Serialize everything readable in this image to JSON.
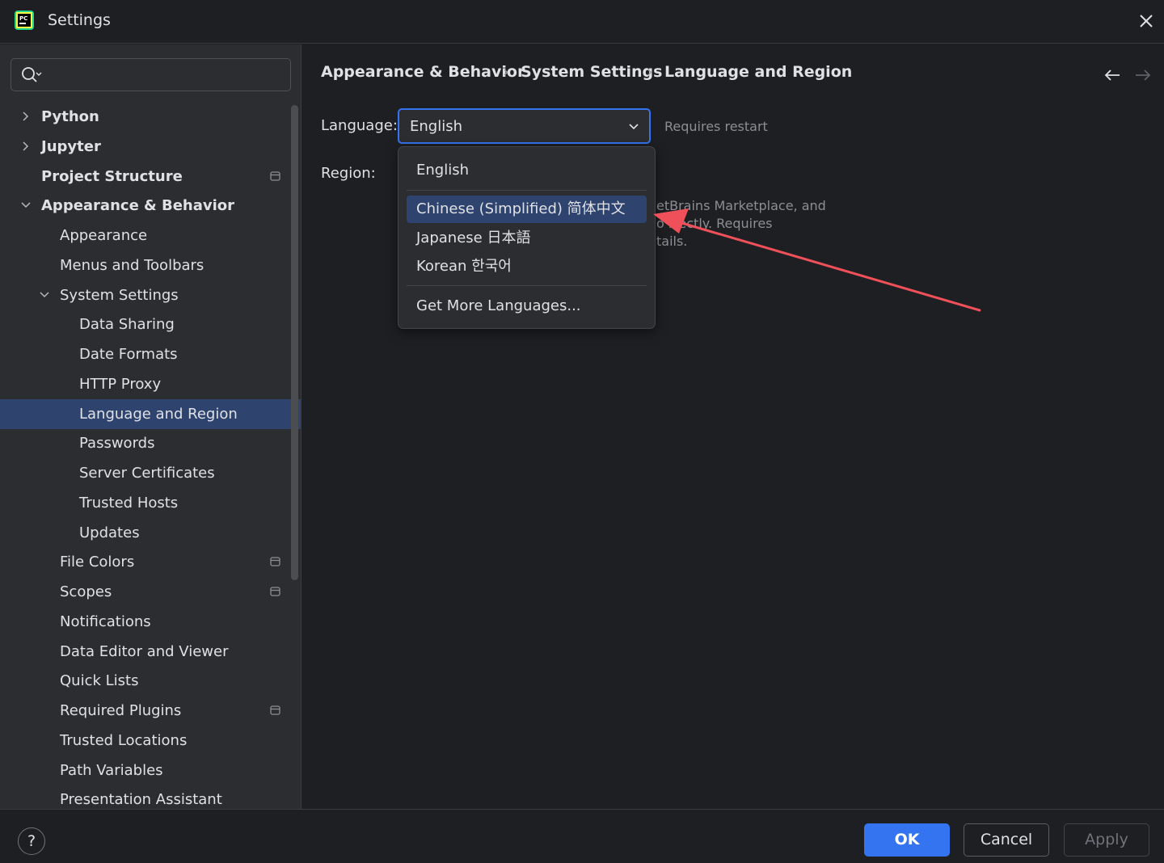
{
  "window": {
    "title": "Settings"
  },
  "search": {
    "placeholder": "",
    "value": ""
  },
  "sidebar": {
    "items": [
      {
        "label": "Python",
        "level": 0,
        "expandable": true,
        "expanded": false,
        "bold": true
      },
      {
        "label": "Jupyter",
        "level": 0,
        "expandable": true,
        "expanded": false,
        "bold": true
      },
      {
        "label": "Project Structure",
        "level": 0,
        "bold": true,
        "tag": true
      },
      {
        "label": "Appearance & Behavior",
        "level": 0,
        "expandable": true,
        "expanded": true,
        "bold": true
      },
      {
        "label": "Appearance",
        "level": 1
      },
      {
        "label": "Menus and Toolbars",
        "level": 1
      },
      {
        "label": "System Settings",
        "level": 1,
        "expandable": true,
        "expanded": true
      },
      {
        "label": "Data Sharing",
        "level": 2
      },
      {
        "label": "Date Formats",
        "level": 2
      },
      {
        "label": "HTTP Proxy",
        "level": 2
      },
      {
        "label": "Language and Region",
        "level": 2,
        "selected": true
      },
      {
        "label": "Passwords",
        "level": 2
      },
      {
        "label": "Server Certificates",
        "level": 2
      },
      {
        "label": "Trusted Hosts",
        "level": 2
      },
      {
        "label": "Updates",
        "level": 2
      },
      {
        "label": "File Colors",
        "level": 1,
        "tag": true
      },
      {
        "label": "Scopes",
        "level": 1,
        "tag": true
      },
      {
        "label": "Notifications",
        "level": 1
      },
      {
        "label": "Data Editor and Viewer",
        "level": 1
      },
      {
        "label": "Quick Lists",
        "level": 1
      },
      {
        "label": "Required Plugins",
        "level": 1,
        "tag": true
      },
      {
        "label": "Trusted Locations",
        "level": 1
      },
      {
        "label": "Path Variables",
        "level": 1
      },
      {
        "label": "Presentation Assistant",
        "level": 1
      }
    ]
  },
  "breadcrumb": {
    "items": [
      "Appearance & Behavior",
      "System Settings",
      "Language and Region"
    ],
    "separator": "›"
  },
  "main": {
    "language_label": "Language:",
    "language_value": "English",
    "requires_restart": "Requires restart",
    "region_label": "Region:",
    "background_text": [
      "etBrains Marketplace, and",
      "o    rrectly. Requires",
      "tails."
    ]
  },
  "dropdown": {
    "options": [
      {
        "label": "English",
        "selected": false
      },
      {
        "label": "Chinese (Simplified) 简体中文",
        "selected": true
      },
      {
        "label": "Japanese 日本語",
        "selected": false
      },
      {
        "label": "Korean 한국어",
        "selected": false
      }
    ],
    "more_label": "Get More Languages..."
  },
  "footer": {
    "help_label": "?",
    "ok_label": "OK",
    "cancel_label": "Cancel",
    "apply_label": "Apply"
  },
  "colors": {
    "accent": "#3574f0",
    "selection": "#2e436e",
    "annotation_arrow": "#f0505a"
  }
}
